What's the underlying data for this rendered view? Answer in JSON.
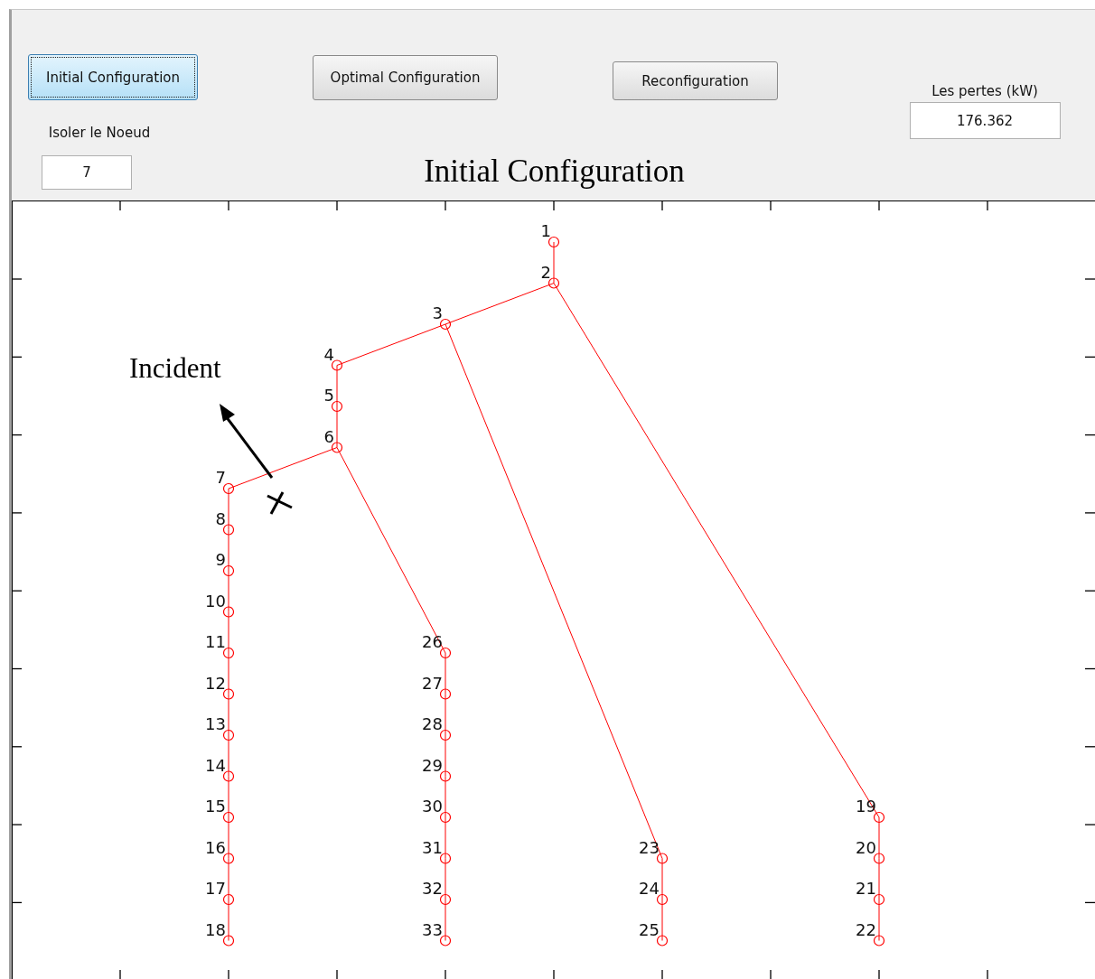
{
  "buttons": [
    {
      "label": "Initial Configuration",
      "selected": true
    },
    {
      "label": "Optimal Configuration",
      "selected": false
    },
    {
      "label": "Reconfiguration",
      "selected": false
    }
  ],
  "isolate_node": {
    "label": "Isoler le Noeud",
    "value": "7"
  },
  "losses": {
    "label": "Les pertes (kW)",
    "value": "176.362"
  },
  "plot": {
    "title": "Initial Configuration",
    "annotation": "Incident",
    "tree": {
      "label": "1",
      "children": [
        {
          "label": "2",
          "children": [
            {
              "label": "3",
              "children": [
                {
                  "label": "4",
                  "children": [
                    {
                      "label": "5",
                      "children": [
                        {
                          "label": "6",
                          "children": [
                            {
                              "label": "7",
                              "children": [
                                {
                                  "label": "8",
                                  "children": [
                                    {
                                      "label": "9",
                                      "children": [
                                        {
                                          "label": "10",
                                          "children": [
                                            {
                                              "label": "11",
                                              "children": [
                                                {
                                                  "label": "12",
                                                  "children": [
                                                    {
                                                      "label": "13",
                                                      "children": [
                                                        {
                                                          "label": "14",
                                                          "children": [
                                                            {
                                                              "label": "15",
                                                              "children": [
                                                                {
                                                                  "label": "16",
                                                                  "children": [
                                                                    {
                                                                      "label": "17",
                                                                      "children": [
                                                                        {
                                                                          "label": "18"
                                                                        }
                                                                      ]
                                                                    }
                                                                  ]
                                                                }
                                                              ]
                                                            }
                                                          ]
                                                        }
                                                      ]
                                                    }
                                                  ]
                                                }
                                              ]
                                            }
                                          ]
                                        }
                                      ]
                                    }
                                  ]
                                }
                              ]
                            },
                            {
                              "label": "26",
                              "children": [
                                {
                                  "label": "27",
                                  "children": [
                                    {
                                      "label": "28",
                                      "children": [
                                        {
                                          "label": "29",
                                          "children": [
                                            {
                                              "label": "30",
                                              "children": [
                                                {
                                                  "label": "31",
                                                  "children": [
                                                    {
                                                      "label": "32",
                                                      "children": [
                                                        {
                                                          "label": "33"
                                                        }
                                                      ]
                                                    }
                                                  ]
                                                }
                                              ]
                                            }
                                          ]
                                        }
                                      ]
                                    }
                                  ]
                                }
                              ]
                            }
                          ]
                        }
                      ]
                    }
                  ]
                },
                {
                  "label": "23",
                  "children": [
                    {
                      "label": "24",
                      "children": [
                        {
                          "label": "25"
                        }
                      ]
                    }
                  ]
                }
              ]
            },
            {
              "label": "19",
              "children": [
                {
                  "label": "20",
                  "children": [
                    {
                      "label": "21",
                      "children": [
                        {
                          "label": "22"
                        }
                      ]
                    }
                  ]
                }
              ]
            }
          ]
        }
      ]
    }
  }
}
